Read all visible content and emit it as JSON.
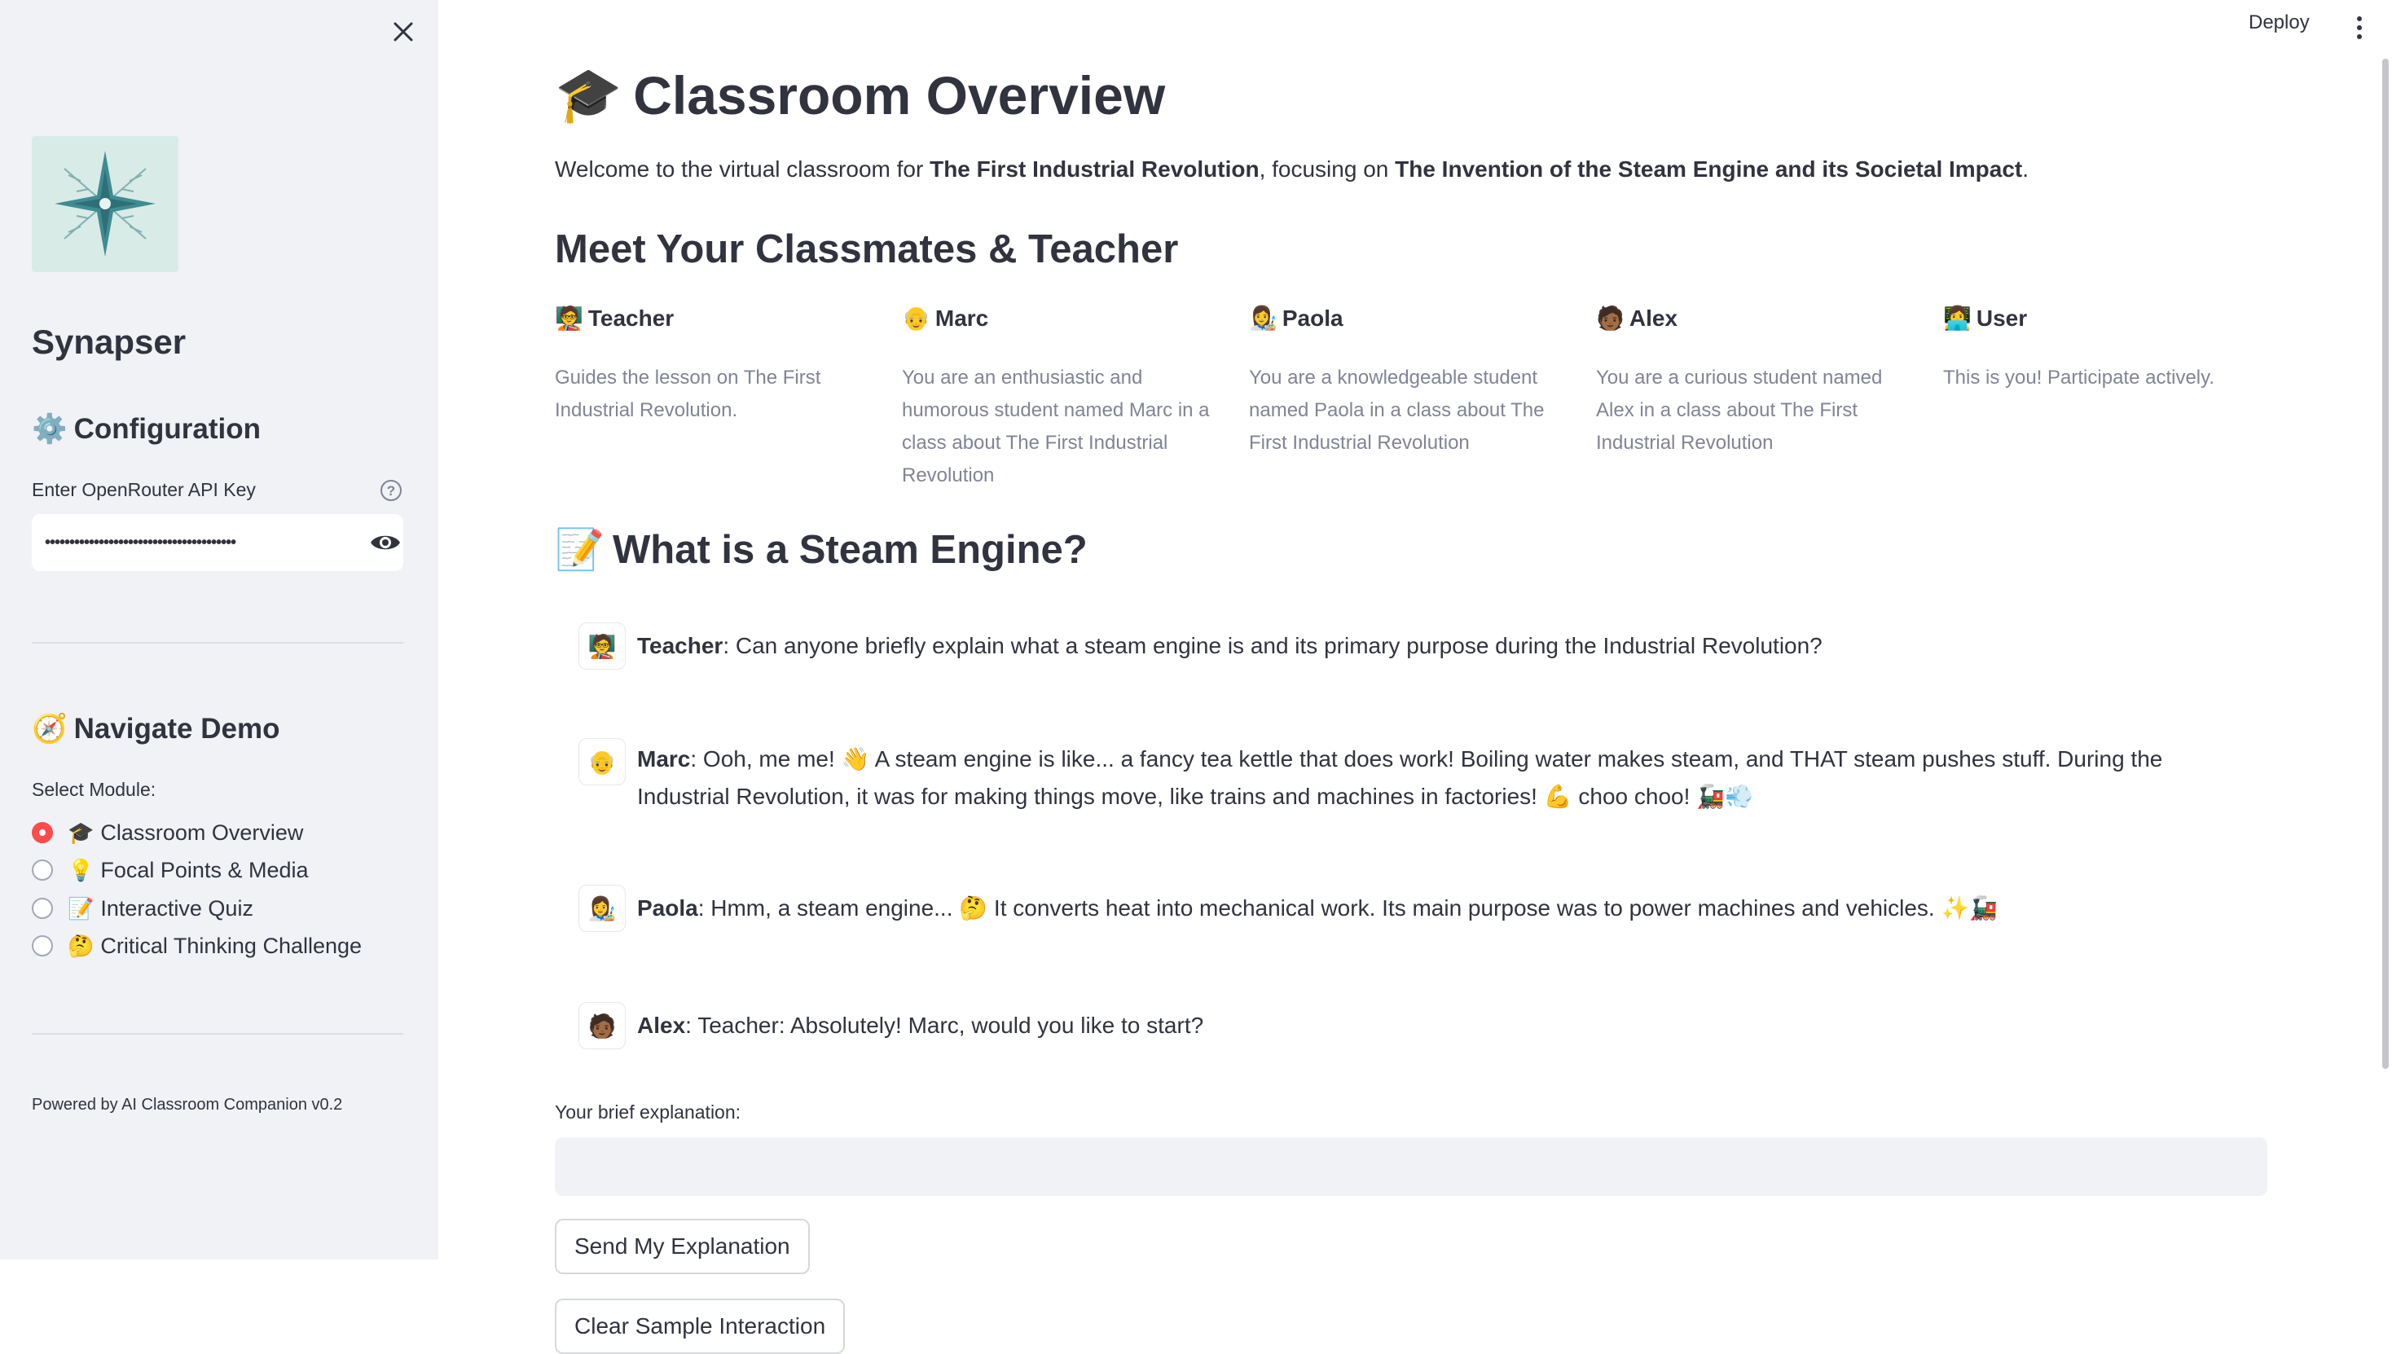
{
  "sidebar": {
    "app_name": "Synapser",
    "config_heading": "Configuration",
    "api_key_label": "Enter OpenRouter API Key",
    "api_key_value": "•••••••••••••••••••••••••••••••••••••••",
    "navigate_heading": "Navigate Demo",
    "select_label": "Select Module:",
    "modules": [
      {
        "emoji": "🎓",
        "label": "Classroom Overview",
        "selected": true
      },
      {
        "emoji": "💡",
        "label": "Focal Points & Media",
        "selected": false
      },
      {
        "emoji": "📝",
        "label": "Interactive Quiz",
        "selected": false
      },
      {
        "emoji": "🤔",
        "label": "Critical Thinking Challenge",
        "selected": false
      }
    ],
    "powered_by": "Powered by AI Classroom Companion v0.2"
  },
  "header": {
    "deploy_label": "Deploy"
  },
  "main": {
    "title_emoji": "🎓",
    "title": "Classroom Overview",
    "welcome_prefix": "Welcome to the virtual classroom for ",
    "welcome_topic": "The First Industrial Revolution",
    "welcome_mid": ", focusing on ",
    "welcome_focus": "The Invention of the Steam Engine and its Societal Impact",
    "welcome_suffix": ".",
    "classmates_heading": "Meet Your Classmates & Teacher",
    "people": [
      {
        "emoji": "🧑‍🏫",
        "name": "Teacher",
        "desc": "Guides the lesson on The First Industrial Revolution."
      },
      {
        "emoji": "👴",
        "name": "Marc",
        "desc": "You are an enthusiastic and humorous student named Marc in a class about The First Industrial Revolution"
      },
      {
        "emoji": "👩‍🎨",
        "name": "Paola",
        "desc": "You are a knowledgeable student named Paola in a class about The First Industrial Revolution"
      },
      {
        "emoji": "🧑🏾",
        "name": "Alex",
        "desc": "You are a curious student named Alex in a class about The First Industrial Revolution"
      },
      {
        "emoji": "👩‍💻",
        "name": "User",
        "desc": "This is you! Participate actively."
      }
    ],
    "question_emoji": "📝",
    "question_heading": "What is a Steam Engine?",
    "messages": [
      {
        "avatar": "🧑‍🏫",
        "speaker": "Teacher",
        "text": ": Can anyone briefly explain what a steam engine is and its primary purpose during the Industrial Revolution?"
      },
      {
        "avatar": "👴",
        "speaker": "Marc",
        "text": ": Ooh, me me! 👋 A steam engine is like... a fancy tea kettle that does work! Boiling water makes steam, and THAT steam pushes stuff. During the Industrial Revolution, it was for making things move, like trains and machines in factories! 💪 choo choo! 🚂💨"
      },
      {
        "avatar": "👩‍🎨",
        "speaker": "Paola",
        "text": ": Hmm, a steam engine... 🤔 It converts heat into mechanical work. Its main purpose was to power machines and vehicles. ✨🚂"
      },
      {
        "avatar": "🧑🏾",
        "speaker": "Alex",
        "text": ": Teacher: Absolutely! Marc, would you like to start?"
      }
    ],
    "input_label": "Your brief explanation:",
    "input_value": "",
    "send_button": "Send My Explanation",
    "clear_button": "Clear Sample Interaction"
  },
  "colors": {
    "accent": "#ff4b4b",
    "sidebar_bg": "#f0f2f6",
    "text": "#31333f",
    "muted_text": "#808495"
  }
}
